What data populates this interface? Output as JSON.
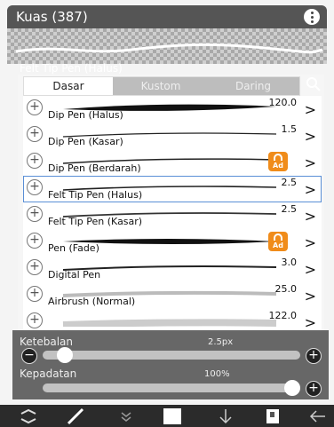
{
  "header": {
    "title": "Kuas (387)"
  },
  "current_brush": "Felt Tip Pen (Halus)",
  "tabs": [
    {
      "label": "Dasar",
      "active": true
    },
    {
      "label": "Kustom",
      "active": false
    },
    {
      "label": "Daring",
      "active": false
    }
  ],
  "brushes": [
    {
      "name": "Dip Pen (Halus)",
      "size": "120.0",
      "locked": false,
      "selected": false
    },
    {
      "name": "Dip Pen (Kasar)",
      "size": "1.5",
      "locked": false,
      "selected": false
    },
    {
      "name": "Dip Pen (Berdarah)",
      "size": "",
      "locked": true,
      "selected": false
    },
    {
      "name": "Felt Tip Pen (Halus)",
      "size": "2.5",
      "locked": false,
      "selected": true
    },
    {
      "name": "Felt Tip Pen (Kasar)",
      "size": "2.5",
      "locked": false,
      "selected": false
    },
    {
      "name": "Pen (Fade)",
      "size": "",
      "locked": true,
      "selected": false
    },
    {
      "name": "Digital Pen",
      "size": "3.0",
      "locked": false,
      "selected": false
    },
    {
      "name": "Airbrush (Normal)",
      "size": "25.0",
      "locked": false,
      "selected": false
    },
    {
      "name": "",
      "size": "122.0",
      "locked": false,
      "selected": false
    }
  ],
  "lock_badge": "Ad",
  "thickness": {
    "label": "Ketebalan",
    "value": "2.5px",
    "level": 0.06
  },
  "density": {
    "label": "Kepadatan",
    "value": "100%",
    "level": 1.0
  },
  "icons": {
    "menu": "more-icon",
    "search": "search-icon",
    "toolbar": [
      "transform-icon",
      "brush-icon",
      "expand-icon",
      "color-icon",
      "download-icon",
      "layer-icon",
      "back-icon"
    ]
  },
  "colors": {
    "accent": "#5a8fd6",
    "lock": "#f08c1a"
  }
}
